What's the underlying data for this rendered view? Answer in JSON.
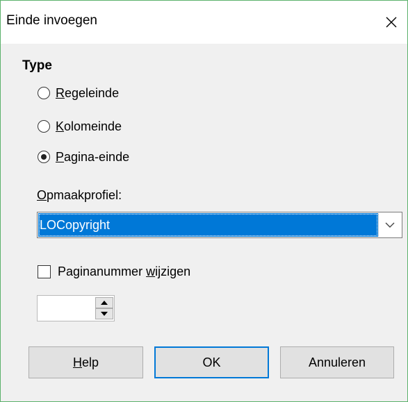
{
  "window": {
    "title": "Einde invoegen",
    "close_glyph": "×"
  },
  "type_section": {
    "title": "Type",
    "options": [
      {
        "mnemonic": "R",
        "rest": "egeleinde",
        "checked": false
      },
      {
        "mnemonic": "K",
        "rest": "olomeinde",
        "checked": false
      },
      {
        "mnemonic": "P",
        "rest": "agina-einde",
        "checked": true
      }
    ]
  },
  "profile": {
    "label_mnemonic": "O",
    "label_rest": "pmaakprofiel:",
    "selected_value": "LOCopyright"
  },
  "page_number": {
    "label_before": "Paginanummer ",
    "label_mnemonic": "w",
    "label_after": "ijzigen",
    "checked": false,
    "value": ""
  },
  "buttons": {
    "help_mnemonic": "H",
    "help_rest": "elp",
    "ok": "OK",
    "cancel": "Annuleren"
  },
  "colors": {
    "accent": "#0078d7",
    "window_border": "#5bb16b",
    "dialog_bg": "#f0f0f0"
  },
  "icons": {
    "close": "close-icon",
    "dropdown": "chevron-down-icon",
    "spin_up": "triangle-up-icon",
    "spin_down": "triangle-down-icon"
  }
}
